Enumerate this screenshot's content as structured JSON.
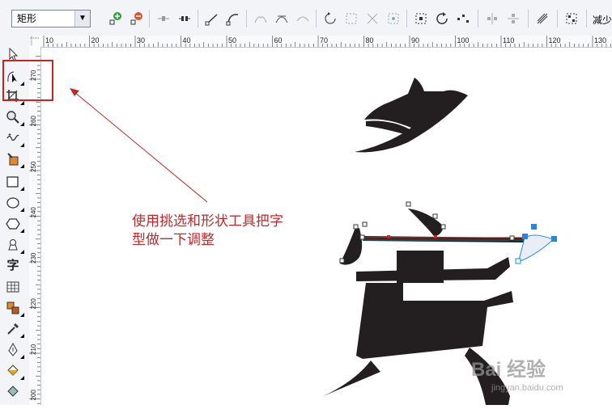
{
  "toolbar": {
    "shape_select_value": "矩形",
    "right_label": "减少"
  },
  "ruler": {
    "horizontal_ticks": [
      "10",
      "20",
      "30",
      "40",
      "50",
      "60",
      "70",
      "80",
      "90",
      "100",
      "110",
      "120",
      "130"
    ],
    "vertical_ticks": [
      "270",
      "260",
      "250",
      "240",
      "230",
      "220",
      "210",
      "200"
    ]
  },
  "annotation": {
    "text_line1": "使用挑选和形状工具把字",
    "text_line2": "型做一下调整",
    "color": "#c0282a"
  },
  "toolbox": {
    "tools": [
      "pick-tool",
      "shape-tool",
      "crop-tool",
      "zoom-tool",
      "freehand-tool",
      "smart-fill-tool",
      "rectangle-tool",
      "ellipse-tool",
      "polygon-tool",
      "basic-shapes-tool",
      "text-tool",
      "table-tool",
      "interactive-blend-tool",
      "eyedropper-tool",
      "outline-pen-tool",
      "fill-tool",
      "interactive-fill-tool"
    ],
    "text_tool_label": "字"
  },
  "watermark": {
    "brand": "Bai 经验",
    "url": "jingyan.baidu.com"
  }
}
